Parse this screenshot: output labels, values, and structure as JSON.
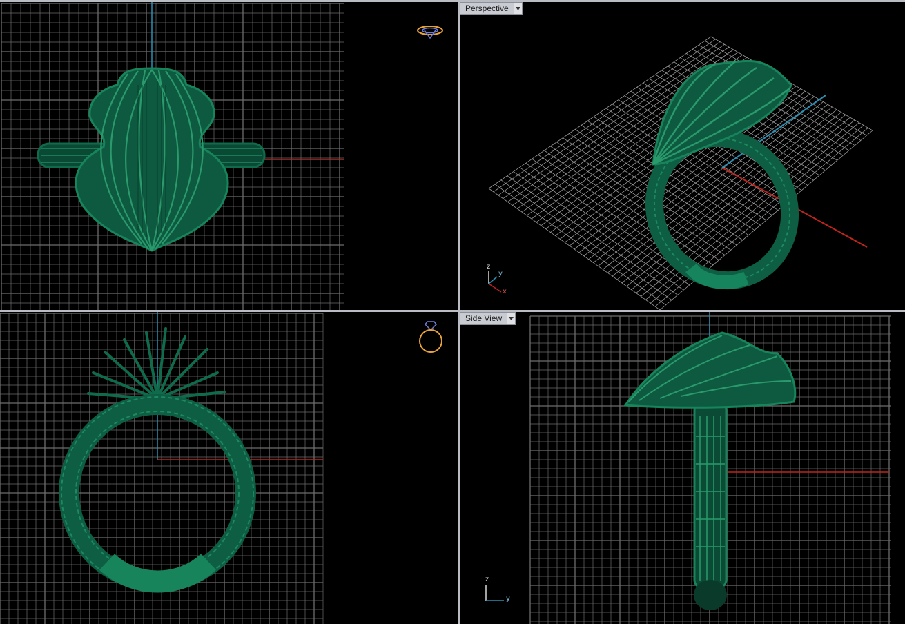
{
  "app": {
    "accent": "#e8a23a",
    "model_color": "#0f6b4c",
    "grid_color": "#6d6d6d",
    "x_axis_color": "#c0241c",
    "y_axis_color": "#2a8fb5"
  },
  "viewports": {
    "top_left": {
      "view": "front",
      "thumbnail_icon": "ring-top-icon"
    },
    "top_right": {
      "label": "Perspective",
      "axis_z": "z",
      "axis_y": "y",
      "axis_x": "x"
    },
    "bottom_left": {
      "view": "side",
      "thumbnail_icon": "ring-side-icon"
    },
    "bottom_right": {
      "label": "Side View",
      "axis_z": "z",
      "axis_y": "y"
    }
  }
}
